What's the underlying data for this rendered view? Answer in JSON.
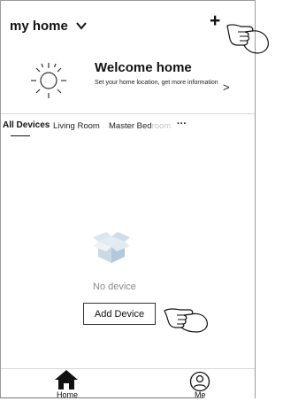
{
  "header": {
    "home_title": "my home",
    "add_symbol": "+"
  },
  "welcome": {
    "title": "Welcome home",
    "subtitle": "Set your home location, get more information",
    "arrow": ">"
  },
  "tabs": {
    "all": "All Devices",
    "living": "Living Room",
    "master_visible": "Master Bed",
    "master_faded": "room",
    "more": "···"
  },
  "empty_state": {
    "message": "No device",
    "button_label": "Add Device"
  },
  "bottom_nav": {
    "home_label": "Home",
    "me_label": "Me"
  },
  "colors": {
    "text": "#111111",
    "muted": "#8a8a8a",
    "divider": "#d8d8d8",
    "box_fill": "#c9d9e6"
  },
  "icons": [
    "chevron-down-icon",
    "sun-icon",
    "empty-box-icon",
    "home-icon",
    "user-icon",
    "pointing-hand-icon"
  ]
}
